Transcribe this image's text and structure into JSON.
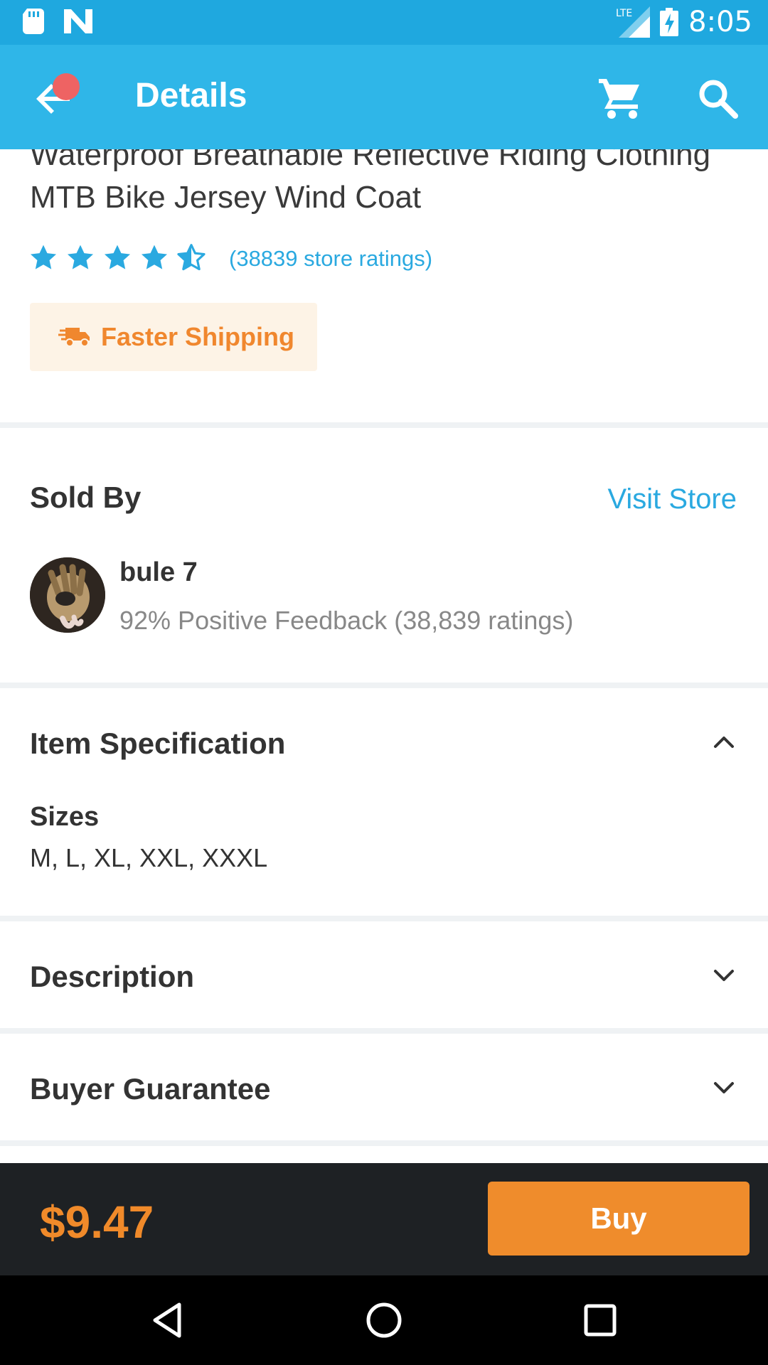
{
  "status_bar": {
    "time": "8:05",
    "network": "LTE",
    "icons": [
      "sd-card-icon",
      "n-notification-icon",
      "lte-signal-icon",
      "battery-charging-icon"
    ]
  },
  "app_bar": {
    "title": "Details",
    "icons": [
      "back-arrow-icon",
      "cart-icon",
      "search-icon"
    ],
    "notification_dot_color": "#ee6363",
    "background": "#2fb6e8"
  },
  "product": {
    "title": "Waterproof Breathable Reflective Riding Clothing MTB Bike Jersey Wind Coat",
    "rating": 4.5,
    "rating_max": 5,
    "ratings_text": "(38839 store ratings)",
    "shipping_badge": "Faster Shipping"
  },
  "seller": {
    "section_title": "Sold By",
    "visit_label": "Visit Store",
    "name": "bule 7",
    "feedback": "92% Positive Feedback (38,839 ratings)"
  },
  "spec": {
    "section_title": "Item Specification",
    "key": "Sizes",
    "value": "M, L, XL, XXL, XXXL",
    "expanded": true
  },
  "description": {
    "section_title": "Description",
    "expanded": false
  },
  "guarantee": {
    "section_title": "Buyer Guarantee",
    "expanded": false
  },
  "bottom_bar": {
    "price": "$9.47",
    "buy_label": "Buy",
    "accent": "#ef8c2c"
  },
  "nav": {
    "icons": [
      "back-triangle-icon",
      "home-circle-icon",
      "recents-square-icon"
    ]
  }
}
